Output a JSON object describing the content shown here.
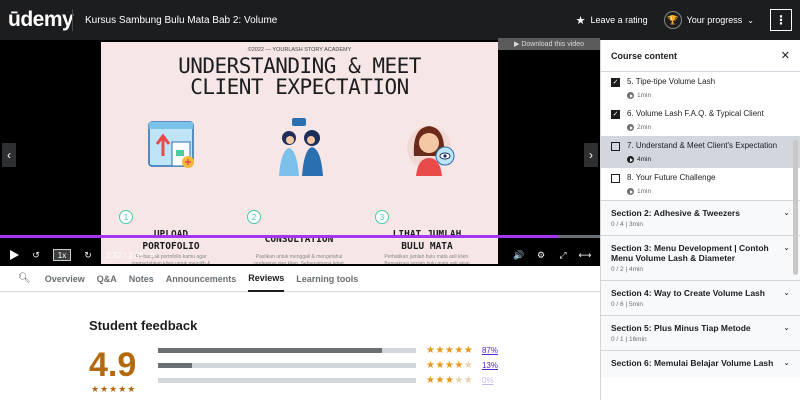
{
  "header": {
    "logo": "ūdemy",
    "course_title": "Kursus Sambung Bulu Mata Bab 2: Volume",
    "leave_rating": "Leave a rating",
    "your_progress": "Your progress",
    "more": "⋮"
  },
  "video": {
    "download_label": "▶ Download this video",
    "slide": {
      "copyright": "©2022 — YOURLASH STORY ACADEMY",
      "title_line1": "UNDERSTANDING & MEET",
      "title_line2": "CLIENT EXPECTATION",
      "columns": [
        {
          "num": "1",
          "head_l1": "UPLOAD",
          "head_l2": "PORTOFOLIO",
          "desc": "Perbanyak portofolio kamu agar memudahkan klien untuk memilih & menentukan model berdasarkan foto serta pengalaman sebelumnya."
        },
        {
          "num": "2",
          "head_l1": "CONSULTATION",
          "head_l2": "",
          "desc": "Pastikan untuk menggali & mengetahui preferensi dari klien. Sebagaimana lebat hasil yang diinginkan, serta panjang dan tingkat kelentikannya."
        },
        {
          "num": "3",
          "head_l1": "LIHAT JUMLAH",
          "head_l2": "BULU MATA",
          "desc": "Perhatikan jumlah bulu mata asli klien. Banyaknya jumlah bulu mata asli akan mempengaruhi hasil volume lashes."
        }
      ]
    },
    "progress_fraction": 0.93,
    "speed": "1x",
    "time": "2:32 / 3:35"
  },
  "tabs": [
    "Overview",
    "Q&A",
    "Notes",
    "Announcements",
    "Reviews",
    "Learning tools"
  ],
  "active_tab": "Reviews",
  "feedback": {
    "title": "Student feedback",
    "rating": "4.9",
    "mini_stars": "★★★★★",
    "rows": [
      {
        "stars": 5,
        "percent": 87,
        "label": "87%"
      },
      {
        "stars": 4,
        "percent": 13,
        "label": "13%"
      },
      {
        "stars": 3,
        "percent": 0,
        "label": "0%"
      }
    ]
  },
  "sidebar": {
    "title": "Course content",
    "lectures": [
      {
        "title": "5. Tipe-tipe Volume Lash",
        "duration": "1min",
        "checked": true
      },
      {
        "title": "6. Volume Lash F.A.Q. & Typical Client",
        "duration": "2min",
        "checked": true
      },
      {
        "title": "7. Understand & Meet Client's Expectation",
        "duration": "4min",
        "checked": false,
        "current": true
      },
      {
        "title": "8. Your Future Challenge",
        "duration": "1min",
        "checked": false
      }
    ],
    "sections": [
      {
        "title": "Section 2: Adhesive & Tweezers",
        "meta": "0 / 4 | 3min"
      },
      {
        "title": "Section 3: Menu Development | Contoh Menu Volume Lash & Diameter",
        "meta": "0 / 2 | 4min"
      },
      {
        "title": "Section 4: Way to Create Volume Lash",
        "meta": "0 / 6 | 5min"
      },
      {
        "title": "Section 5: Plus Minus Tiap Metode",
        "meta": "0 / 1 | 16min"
      },
      {
        "title": "Section 6: Memulai Belajar Volume Lash",
        "meta": ""
      }
    ]
  },
  "colors": {
    "accent": "#a435f0",
    "rating": "#b4690e",
    "star": "#e59819",
    "link": "#5624d0",
    "dark": "#1c1d1f"
  }
}
